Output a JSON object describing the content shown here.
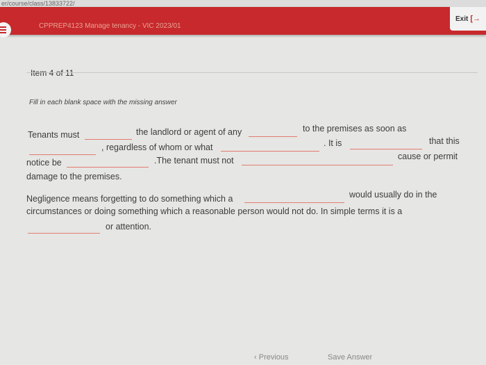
{
  "browser": {
    "url": "er/course/class/13833722/"
  },
  "header": {
    "course_title": "CPPREP4123 Manage tenancy - VIC 2023/01",
    "exit_label": "Exit"
  },
  "question": {
    "item_counter": "Item 4 of 11",
    "instruction": "Fill in each blank space with the missing answer",
    "fragments": {
      "p1_a": "Tenants must",
      "p1_b": "the landlord or agent of any",
      "p1_c": "to the premises as soon as",
      "p1_d": ", regardless of whom or what",
      "p1_e": ". It is",
      "p1_f": "that this",
      "p1_g": "notice be",
      "p1_h": ".The tenant must not",
      "p1_i": "cause or permit",
      "p1_j": "damage to the premises.",
      "p2_a": "Negligence means forgetting to do something which a",
      "p2_b": "would usually do in the",
      "p2_c": "circumstances or doing something which a reasonable person would not do. In simple terms it is a",
      "p2_d": "or attention."
    }
  },
  "footer": {
    "previous_label": "Previous",
    "save_label": "Save Answer"
  },
  "colors": {
    "brand": "#c7292c",
    "blank_line": "#e27c6f"
  }
}
